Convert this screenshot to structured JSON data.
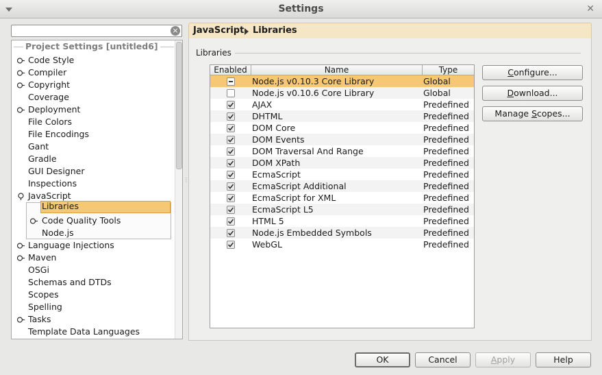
{
  "window": {
    "title": "Settings"
  },
  "search": {
    "value": ""
  },
  "tree": {
    "section_title": "Project Settings [untitled6]",
    "items": [
      {
        "label": "Code Style",
        "expandable": true
      },
      {
        "label": "Compiler",
        "expandable": true
      },
      {
        "label": "Copyright",
        "expandable": true
      },
      {
        "label": "Coverage",
        "expandable": false
      },
      {
        "label": "Deployment",
        "expandable": true
      },
      {
        "label": "File Colors",
        "expandable": false
      },
      {
        "label": "File Encodings",
        "expandable": false
      },
      {
        "label": "Gant",
        "expandable": false
      },
      {
        "label": "Gradle",
        "expandable": false
      },
      {
        "label": "GUI Designer",
        "expandable": false
      },
      {
        "label": "Inspections",
        "expandable": false
      },
      {
        "label": "JavaScript",
        "expandable": true,
        "expanded": true
      },
      {
        "label": "Libraries",
        "selected": true
      },
      {
        "label": "Code Quality Tools",
        "expandable": true
      },
      {
        "label": "Node.js",
        "expandable": false
      },
      {
        "label": "Language Injections",
        "expandable": true
      },
      {
        "label": "Maven",
        "expandable": true
      },
      {
        "label": "OSGi",
        "expandable": false
      },
      {
        "label": "Schemas and DTDs",
        "expandable": false
      },
      {
        "label": "Scopes",
        "expandable": false
      },
      {
        "label": "Spelling",
        "expandable": false
      },
      {
        "label": "Tasks",
        "expandable": true
      },
      {
        "label": "Template Data Languages",
        "expandable": false
      }
    ]
  },
  "breadcrumb": {
    "parent": "JavaScript",
    "current": "Libraries"
  },
  "libraries": {
    "group_label": "Libraries",
    "columns": {
      "enabled": "Enabled",
      "name": "Name",
      "type": "Type"
    },
    "rows": [
      {
        "enabled": "partial",
        "name": "Node.js v0.10.3 Core Library",
        "type": "Global",
        "selected": true
      },
      {
        "enabled": "unchecked",
        "name": "Node.js v0.10.6 Core Library",
        "type": "Global"
      },
      {
        "enabled": "checked",
        "name": "AJAX",
        "type": "Predefined"
      },
      {
        "enabled": "checked",
        "name": "DHTML",
        "type": "Predefined"
      },
      {
        "enabled": "checked",
        "name": "DOM Core",
        "type": "Predefined"
      },
      {
        "enabled": "checked",
        "name": "DOM Events",
        "type": "Predefined"
      },
      {
        "enabled": "checked",
        "name": "DOM Traversal And Range",
        "type": "Predefined"
      },
      {
        "enabled": "checked",
        "name": "DOM XPath",
        "type": "Predefined"
      },
      {
        "enabled": "checked",
        "name": "EcmaScript",
        "type": "Predefined"
      },
      {
        "enabled": "checked",
        "name": "EcmaScript Additional",
        "type": "Predefined"
      },
      {
        "enabled": "checked",
        "name": "EcmaScript for XML",
        "type": "Predefined"
      },
      {
        "enabled": "checked",
        "name": "EcmaScript L5",
        "type": "Predefined"
      },
      {
        "enabled": "checked",
        "name": "HTML 5",
        "type": "Predefined"
      },
      {
        "enabled": "checked",
        "name": "Node.js Embedded Symbols",
        "type": "Predefined"
      },
      {
        "enabled": "checked",
        "name": "WebGL",
        "type": "Predefined"
      }
    ]
  },
  "side_buttons": {
    "configure": {
      "pre": "",
      "mnemonic": "C",
      "post": "onfigure..."
    },
    "download": {
      "pre": "",
      "mnemonic": "D",
      "post": "ownload..."
    },
    "manage_scopes": {
      "pre": "Manage ",
      "mnemonic": "S",
      "post": "copes..."
    }
  },
  "footer": {
    "ok": "OK",
    "cancel": "Cancel",
    "apply": {
      "mnemonic": "A",
      "post": "pply"
    },
    "help": "Help"
  },
  "colors": {
    "selection": "#f6c873",
    "breadcrumb_bg": "#f5e6c6",
    "window_bg": "#e8e8e7"
  },
  "icons": {
    "expander_collapsed": "expander-collapsed-icon",
    "expander_expanded": "expander-expanded-icon",
    "clear": "clear-search-icon"
  }
}
